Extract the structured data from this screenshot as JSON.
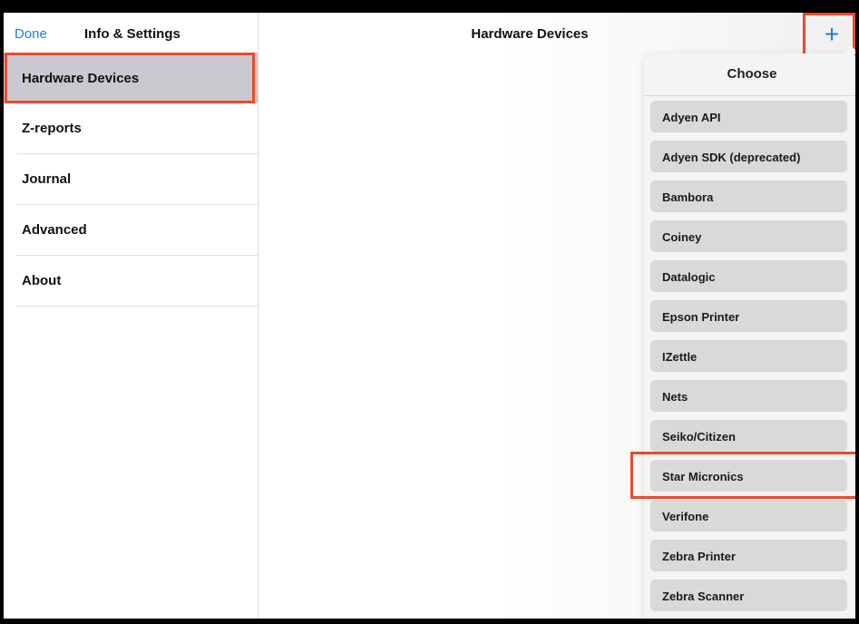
{
  "sidebar": {
    "done_label": "Done",
    "title": "Info & Settings",
    "items": [
      {
        "label": "Hardware Devices",
        "selected": true
      },
      {
        "label": "Z-reports"
      },
      {
        "label": "Journal"
      },
      {
        "label": "Advanced"
      },
      {
        "label": "About"
      }
    ]
  },
  "main": {
    "title": "Hardware Devices",
    "add_icon": "plus-icon"
  },
  "popover": {
    "title": "Choose",
    "options": [
      "Adyen API",
      "Adyen SDK (deprecated)",
      "Bambora",
      "Coiney",
      "Datalogic",
      "Epson Printer",
      "IZettle",
      "Nets",
      "Seiko/Citizen",
      "Star Micronics",
      "Verifone",
      "Zebra Printer",
      "Zebra Scanner"
    ]
  },
  "colors": {
    "accent": "#1a7fe0",
    "highlight": "#ea4a2e",
    "selected_row": "#c9c9cf"
  }
}
